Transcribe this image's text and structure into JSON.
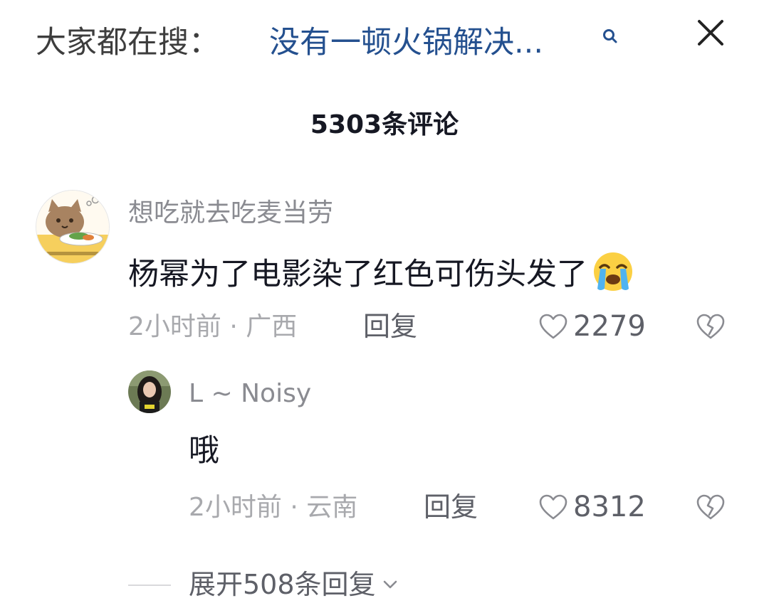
{
  "search": {
    "prefix": "大家都在搜：",
    "query": "没有一顿火锅解决..."
  },
  "comments_title": "5303条评论",
  "comments": [
    {
      "username": "想吃就去吃麦当劳",
      "content": "杨幂为了电影染了红色可伤头发了",
      "emoji": "crying-face-emoji",
      "meta": "2小时前 · 广西",
      "reply_label": "回复",
      "likes": "2279"
    },
    {
      "username": "L ~ Noisy",
      "content": "哦",
      "meta": "2小时前 · 云南",
      "reply_label": "回复",
      "likes": "8312"
    }
  ],
  "expand_label": "展开508条回复",
  "icons": {
    "search": "search-icon",
    "close": "close-icon",
    "like": "heart-outline-icon",
    "dislike": "broken-heart-icon",
    "expand": "chevron-down-icon"
  },
  "colors": {
    "query_link": "#24508f",
    "muted": "#a8a9ad",
    "text": "#161823"
  }
}
